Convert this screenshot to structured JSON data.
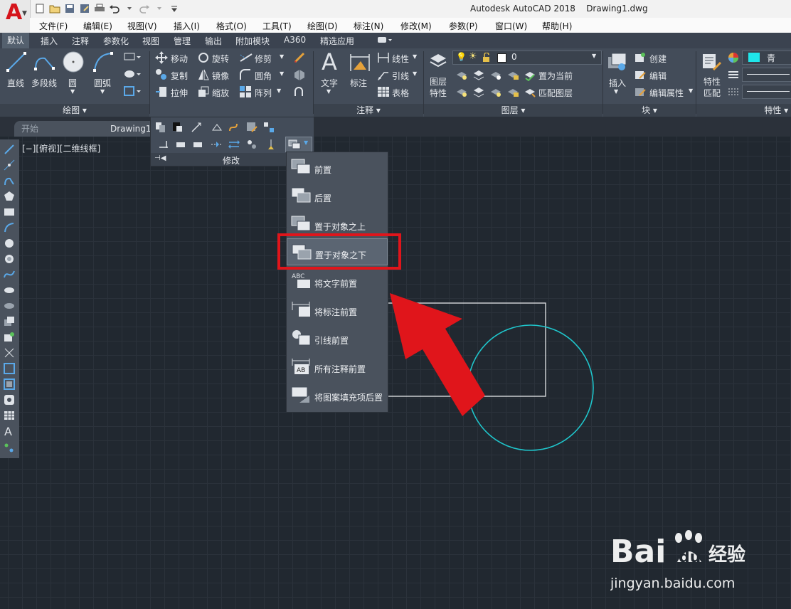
{
  "app": {
    "logo_letter": "A",
    "title": "Autodesk AutoCAD 2018",
    "filename": "Drawing1.dwg"
  },
  "menu": [
    "文件(F)",
    "编辑(E)",
    "视图(V)",
    "插入(I)",
    "格式(O)",
    "工具(T)",
    "绘图(D)",
    "标注(N)",
    "修改(M)",
    "参数(P)",
    "窗口(W)",
    "帮助(H)"
  ],
  "ribbon_tabs": [
    "默认",
    "插入",
    "注释",
    "参数化",
    "视图",
    "管理",
    "输出",
    "附加模块",
    "A360",
    "精选应用"
  ],
  "draw_panel": {
    "title": "绘图",
    "tools": [
      "直线",
      "多段线",
      "圆",
      "圆弧"
    ]
  },
  "modify_panel": {
    "title": "修改",
    "tools": [
      "移动",
      "旋转",
      "修剪",
      "复制",
      "镜像",
      "圆角",
      "拉伸",
      "缩放",
      "阵列"
    ]
  },
  "annotate_panel": {
    "title": "注释",
    "tools": [
      "文字",
      "标注",
      "线性",
      "引线",
      "表格"
    ]
  },
  "layer_panel": {
    "title": "图层",
    "layer_props": [
      "图层",
      "特性"
    ],
    "current_layer": "0",
    "tools": [
      "置为当前",
      "匹配图层"
    ]
  },
  "block_panel": {
    "title": "块",
    "tools": [
      "插入",
      "创建",
      "编辑",
      "编辑属性"
    ]
  },
  "properties_panel": {
    "title": "特性",
    "match": [
      "特性",
      "匹配"
    ],
    "color_name": "青"
  },
  "doc_tabs": [
    "开始",
    "Drawing1"
  ],
  "viewport_label": "[−][俯视][二维线框]",
  "draworder_menu": [
    "前置",
    "后置",
    "置于对象之上",
    "置于对象之下",
    "将文字前置",
    "将标注前置",
    "引线前置",
    "所有注释前置",
    "将图案填充项后置"
  ],
  "watermark": {
    "brand": "Bai",
    "brand2": "du",
    "cn": "经验",
    "url": "jingyan.baidu.com"
  },
  "colors": {
    "accent_red": "#e0151b",
    "circle_cyan": "#1fc6cc",
    "ribbon_bg": "#434c59",
    "canvas_bg": "#212830"
  }
}
